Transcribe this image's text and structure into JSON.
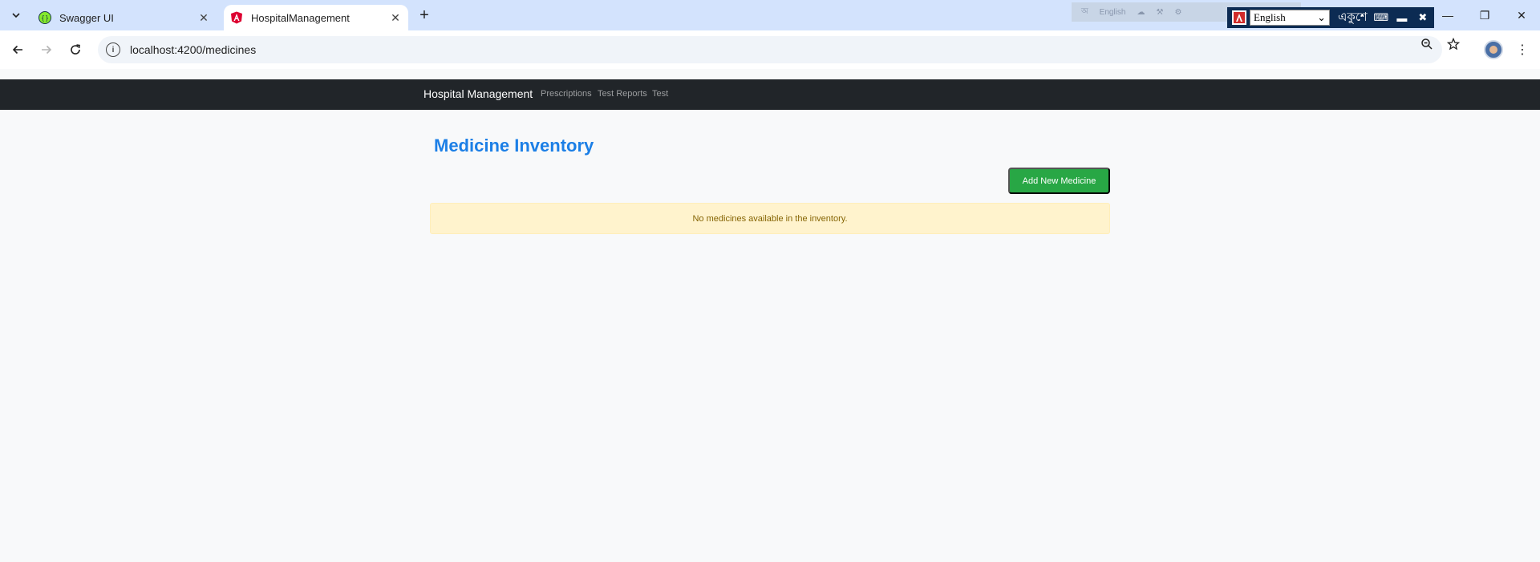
{
  "browser": {
    "tabs": [
      {
        "title": "Swagger UI",
        "active": false
      },
      {
        "title": "HospitalManagement",
        "active": true
      }
    ],
    "address_bar": {
      "url": "localhost:4200/medicines"
    },
    "icons": {
      "tab_search": "chevron-down-icon",
      "back": "back-arrow-icon",
      "forward": "forward-arrow-icon",
      "reload": "reload-icon",
      "site_info": "info-icon",
      "zoom": "zoom-out-icon",
      "bookmark": "star-icon",
      "profile": "avatar",
      "menu": "kebab-menu-icon"
    },
    "colors": {
      "tabstrip": "#d3e3fd",
      "omnibox": "#f0f4f9"
    }
  },
  "language_toolbar": {
    "faded_label": "English",
    "selected_language": "English",
    "brand_text": "একুশে"
  },
  "app": {
    "navbar": {
      "brand": "Hospital Management",
      "links": [
        "Prescriptions",
        "Test Reports",
        "Test"
      ]
    },
    "page_title": "Medicine Inventory",
    "add_button_label": "Add New Medicine",
    "empty_message": "No medicines available in the inventory.",
    "colors": {
      "navbar": "#212529",
      "title": "#1c7fe6",
      "primary_action": "#28a745",
      "alert_bg": "#fff3cd",
      "alert_text": "#856404"
    }
  }
}
